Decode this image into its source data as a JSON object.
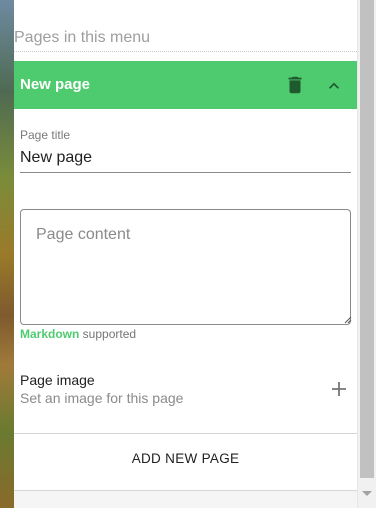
{
  "menu": {
    "section_title": "Pages in this menu"
  },
  "page": {
    "header_title": "New page",
    "title_label": "Page title",
    "title_value": "New page",
    "content_placeholder": "Page content",
    "markdown_link": "Markdown",
    "markdown_suffix": " supported",
    "image_label": "Page image",
    "image_sublabel": "Set an image for this page"
  },
  "actions": {
    "add_page_label": "ADD NEW PAGE"
  },
  "icons": {
    "delete": "trash-icon",
    "collapse": "chevron-up-icon",
    "add_image": "plus-icon"
  },
  "colors": {
    "accent": "#4fcb6f",
    "header_text": "#ffffff",
    "icon_dark": "#1f5a2e"
  }
}
